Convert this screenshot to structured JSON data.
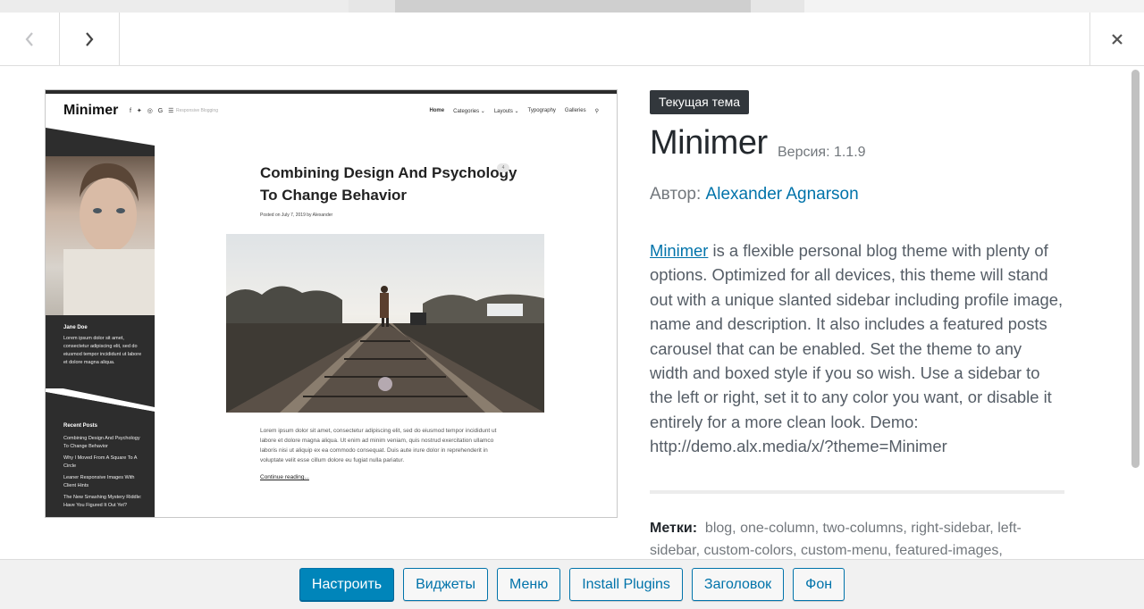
{
  "header": {
    "prev_icon": "chevron-left-icon",
    "next_icon": "chevron-right-icon",
    "close_icon": "close-icon"
  },
  "preview": {
    "site_logo": "Minimer",
    "social": "f ✦ ◎ G ☰",
    "tagline": "Responsive Blogging",
    "menu": [
      "Home",
      "Categories ⌄",
      "Layouts ⌄",
      "Typography",
      "Galleries"
    ],
    "post_title": "Combining Design And Psychology To Change Behavior",
    "post_meta": "Posted on July 7, 2019 by Alexander",
    "post_badge": "4",
    "excerpt": "Lorem ipsum dolor sit amet, consectetur adipiscing elit, sed do eiusmod tempor incididunt ut labore et dolore magna aliqua. Ut enim ad minim veniam, quis nostrud exercitation ullamco laboris nisi ut aliquip ex ea commodo consequat. Duis aute irure dolor in reprehenderit in voluptate velit esse cillum dolore eu fugiat nulla pariatur.",
    "continue": "Continue reading...",
    "sidebar_name": "Jane Doe",
    "sidebar_desc": "Lorem ipsum dolor sit amet, consectetur adipiscing elit, sed do eiusmod tempor incididunt ut labore et dolore magna aliqua.",
    "recent_title": "Recent Posts",
    "recent_posts": [
      "Combining Design And Psychology To Change Behavior",
      "Why I Moved From A Square To A Circle",
      "Leaner Responsive Images With Client Hints",
      "The New Smashing Mystery Riddle: Have You Figured It Out Yet?"
    ]
  },
  "theme": {
    "current_badge": "Текущая тема",
    "name": "Minimer",
    "version": "Версия: 1.1.9",
    "author_label": "Автор:",
    "author_name": "Alexander Agnarson",
    "desc_link": "Minimer",
    "description": " is a flexible personal blog theme with plenty of options. Optimized for all devices, this theme will stand out with a unique slanted sidebar including profile image, name and description. It also includes a featured posts carousel that can be enabled. Set the theme to any width and boxed style if you so wish. Use a sidebar to the left or right, set it to any color you want, or disable it entirely for a more clean look. Demo: http://demo.alx.media/x/?theme=Minimer",
    "tags_label": "Метки:",
    "tags": "blog, one-column, two-columns, right-sidebar, left-sidebar, custom-colors, custom-menu, featured-images,"
  },
  "footer": {
    "customize": "Настроить",
    "widgets": "Виджеты",
    "menus": "Меню",
    "install_plugins": "Install Plugins",
    "header": "Заголовок",
    "background": "Фон"
  },
  "colors": {
    "primary": "#0085ba",
    "link": "#0073aa",
    "badge_bg": "#32373c"
  }
}
